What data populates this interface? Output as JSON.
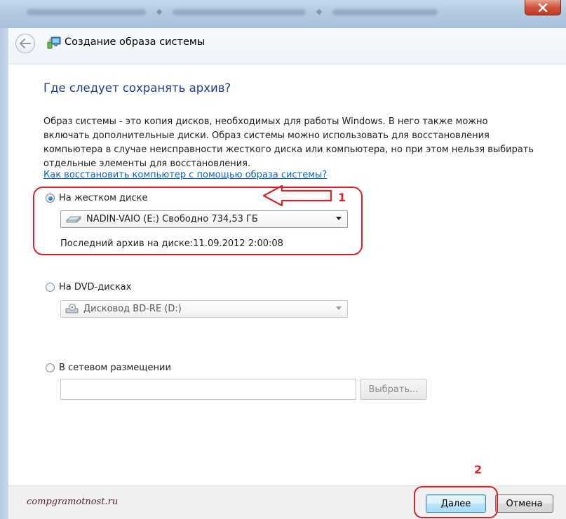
{
  "window": {
    "title": "Создание образа системы"
  },
  "content": {
    "heading": "Где следует сохранять архив?",
    "description": "Образ системы - это копия дисков, необходимых для работы Windows. В него также можно включать дополнительные диски. Образ системы можно использовать для восстановления компьютера в случае неисправности жесткого диска или компьютера, но при этом нельзя выбирать отдельные элементы для восстановления.",
    "help_link": "Как восстановить компьютер с помощью образа системы?"
  },
  "options": {
    "hard_disk": {
      "label": "На жестком диске",
      "selected": true,
      "drive_value": "NADIN-VAIO (E:)  Свободно 734,53 ГБ",
      "last_archive": "Последний архив на диске:11.09.2012 2:00:08"
    },
    "dvd": {
      "label": "На DVD-дисках",
      "selected": false,
      "drive_value": "Дисковод BD-RE (D:)"
    },
    "network": {
      "label": "В сетевом размещении",
      "selected": false,
      "path_value": "",
      "browse_label": "Выбрать..."
    }
  },
  "annotations": {
    "marker_1": "1",
    "marker_2": "2"
  },
  "footer": {
    "watermark": "compgramotnost.ru",
    "next_label": "Далее",
    "cancel_label": "Отмена"
  },
  "colors": {
    "heading": "#1c3d8c",
    "link": "#0a63c9",
    "annotation": "#d8222a"
  },
  "icons": {
    "back": "back-arrow-icon",
    "wizard": "backup-wizard-icon",
    "close": "close-icon",
    "hdd": "hard-drive-icon",
    "dvd": "dvd-drive-icon"
  }
}
